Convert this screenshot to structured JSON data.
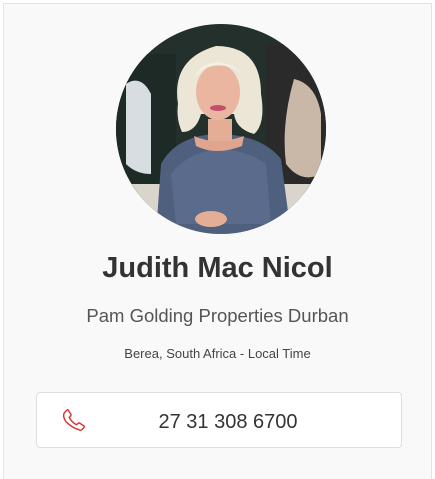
{
  "agent": {
    "name": "Judith Mac Nicol",
    "company": "Pam Golding Properties Durban",
    "location": "Berea, South Africa - Local Time",
    "phone": "27 31 308 6700"
  },
  "icons": {
    "phone": "phone-icon"
  },
  "colors": {
    "card_background": "#f9f9f9",
    "name_text": "#333333",
    "phone_icon": "#d9302c"
  }
}
